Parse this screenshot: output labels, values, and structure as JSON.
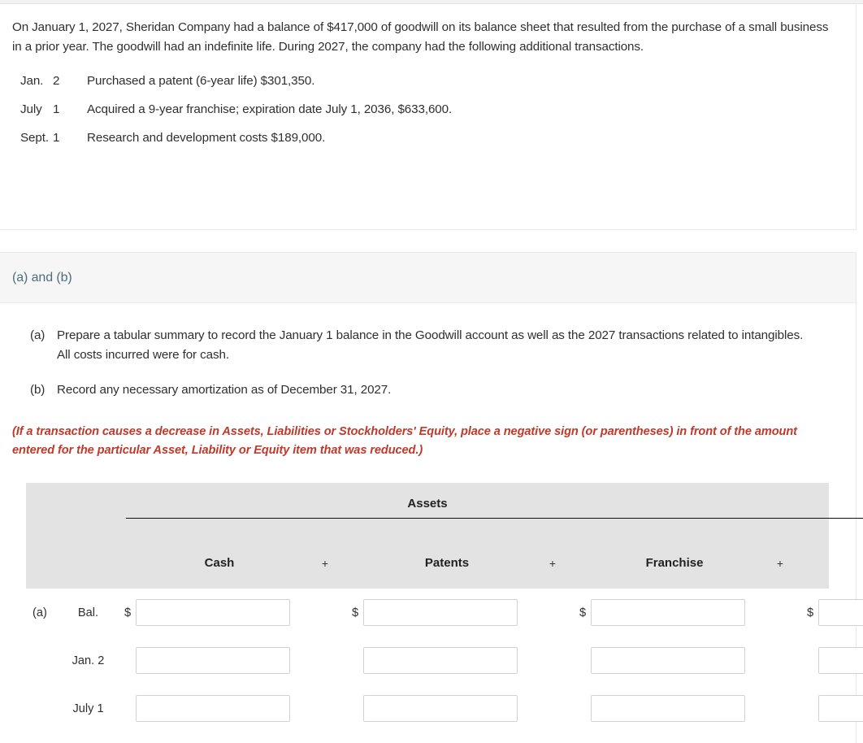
{
  "problem": {
    "intro": "On January 1, 2027, Sheridan Company had a balance of $417,000 of goodwill on its balance sheet that resulted from the purchase of a small business in a prior year. The goodwill had an indefinite life. During 2027, the company had the following additional transactions.",
    "transactions": [
      {
        "month": "Jan.",
        "day": "2",
        "description": "Purchased a patent (6-year life) $301,350."
      },
      {
        "month": "July",
        "day": "1",
        "description": "Acquired a 9-year franchise; expiration date July 1, 2036, $633,600."
      },
      {
        "month": "Sept.",
        "day": "1",
        "description": "Research and development costs $189,000."
      }
    ]
  },
  "requirement": {
    "heading": "(a) and (b)",
    "items": [
      {
        "label": "(a)",
        "text": "Prepare a tabular summary to record the January 1 balance in the Goodwill account as well as the 2027 transactions related to intangibles. All costs incurred were for cash."
      },
      {
        "label": "(b)",
        "text": "Record any necessary amortization as of December 31, 2027."
      }
    ],
    "note": "(If a transaction causes a decrease in Assets, Liabilities or Stockholders' Equity, place a negative sign (or parentheses) in front of the amount entered for the particular Asset, Liability or Equity item that was reduced.)",
    "note_color": "#c0392b",
    "heading_color": "#4d6d7d"
  },
  "table": {
    "group_header": "Assets",
    "columns": [
      {
        "name": "Cash",
        "operator": "+"
      },
      {
        "name": "Patents",
        "operator": "+"
      },
      {
        "name": "Franchise",
        "operator": "+"
      }
    ],
    "rows": [
      {
        "part": "(a)",
        "date": "Bal.",
        "show_dollar": true,
        "cells": [
          {
            "value": "",
            "placeholder": ""
          },
          {
            "value": "",
            "placeholder": ""
          },
          {
            "value": "",
            "placeholder": ""
          },
          {
            "value": "",
            "placeholder": ""
          }
        ]
      },
      {
        "part": "",
        "date": "Jan. 2",
        "show_dollar": false,
        "cells": [
          {
            "value": "",
            "placeholder": ""
          },
          {
            "value": "",
            "placeholder": ""
          },
          {
            "value": "",
            "placeholder": ""
          },
          {
            "value": "",
            "placeholder": ""
          }
        ]
      },
      {
        "part": "",
        "date": "July 1",
        "show_dollar": false,
        "cells": [
          {
            "value": "",
            "placeholder": ""
          },
          {
            "value": "",
            "placeholder": ""
          },
          {
            "value": "",
            "placeholder": ""
          },
          {
            "value": "",
            "placeholder": ""
          }
        ]
      }
    ]
  }
}
